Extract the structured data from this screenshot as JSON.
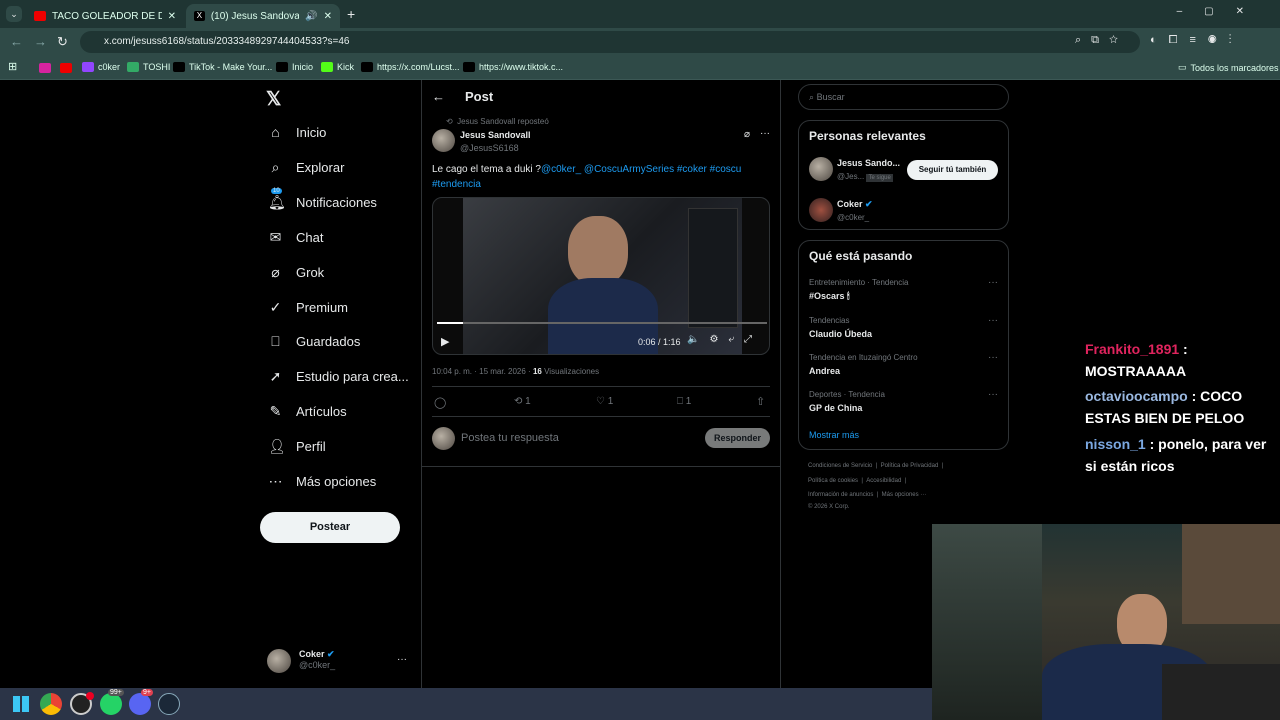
{
  "browser": {
    "tabs": [
      {
        "title": "TACO GOLEADOR DE DRIUSSI Y",
        "icon": "youtube-icon"
      },
      {
        "title": "(10) Jesus Sandovall en X: \"",
        "icon": "x-icon"
      }
    ],
    "url": "x.com/jesuss6168/status/2033348929744404533?s=46",
    "bookmarks": [
      "c0ker",
      "TOSHI",
      "TikTok - Make Your...",
      "Inicio",
      "Kick",
      "https://x.com/Lucst...",
      "https://www.tiktok.c..."
    ],
    "all_bookmarks": "Todos los marcadores"
  },
  "nav": {
    "items": [
      {
        "label": "Inicio",
        "icon": "home-icon"
      },
      {
        "label": "Explorar",
        "icon": "search-icon"
      },
      {
        "label": "Notificaciones",
        "icon": "bell-icon",
        "badge": "10"
      },
      {
        "label": "Chat",
        "icon": "mail-icon"
      },
      {
        "label": "Grok",
        "icon": "grok-icon"
      },
      {
        "label": "Premium",
        "icon": "premium-icon"
      },
      {
        "label": "Guardados",
        "icon": "bookmark-icon"
      },
      {
        "label": "Estudio para crea...",
        "icon": "rocket-icon"
      },
      {
        "label": "Artículos",
        "icon": "article-icon"
      },
      {
        "label": "Perfil",
        "icon": "person-icon"
      },
      {
        "label": "Más opciones",
        "icon": "more-icon"
      }
    ],
    "post_button": "Postear",
    "account": {
      "name": "Coker",
      "handle": "@c0ker_"
    }
  },
  "post": {
    "header": "Post",
    "repost": "Jesus Sandovall reposteó",
    "author": "Jesus Sandovall",
    "handle": "@JesusS6168",
    "text": "Le cago el tema a duki ?",
    "links": [
      "@c0ker_",
      "@CoscuArmySeries",
      "#coker",
      "#coscu",
      "#tendencia"
    ],
    "video_time": "0:06 / 1:16",
    "video_progress": 0.08,
    "meta": "10:04 p. m. · 15 mar. 2026 · ",
    "views": "16",
    "views_label": "Visualizaciones",
    "retweets": "1",
    "likes": "1",
    "bookmarks": "1",
    "reply_placeholder": "Postea tu respuesta",
    "reply_button": "Responder"
  },
  "sidebar": {
    "search_placeholder": "Buscar",
    "people_title": "Personas relevantes",
    "people": [
      {
        "name": "Jesus Sando...",
        "handle": "@Jes...",
        "tag": "Te sigue",
        "button": "Seguir tú también"
      },
      {
        "name": "Coker",
        "handle": "@c0ker_"
      }
    ],
    "trends_title": "Qué está pasando",
    "trends": [
      {
        "context": "Entretenimiento · Tendencia",
        "name": "#Oscars 🕯"
      },
      {
        "context": "Tendencias",
        "name": "Claudio Úbeda"
      },
      {
        "context": "Tendencia en Ituzaingó Centro",
        "name": "Andrea"
      },
      {
        "context": "Deportes · Tendencia",
        "name": "GP de China"
      }
    ],
    "show_more": "Mostrar más",
    "footer": [
      "Condiciones de Servicio",
      "Política de Privacidad",
      "Política de cookies",
      "Accesibilidad",
      "Información de anuncios",
      "Más opciones ···",
      "© 2026 X Corp."
    ]
  },
  "stream_chat": [
    {
      "user": "Frankito_1891",
      "color": "#e0245e",
      "msg": "MOSTRAAAAA"
    },
    {
      "user": "octavioocampo",
      "color": "#9ab8e0",
      "msg": "COCO ESTAS BIEN DE PELOO"
    },
    {
      "user": "nisson_1",
      "color": "#7aa7e0",
      "msg": "ponelo, para ver si están ricos"
    }
  ],
  "taskbar": {
    "whatsapp_badge": "99+",
    "discord_badge": "9+"
  }
}
